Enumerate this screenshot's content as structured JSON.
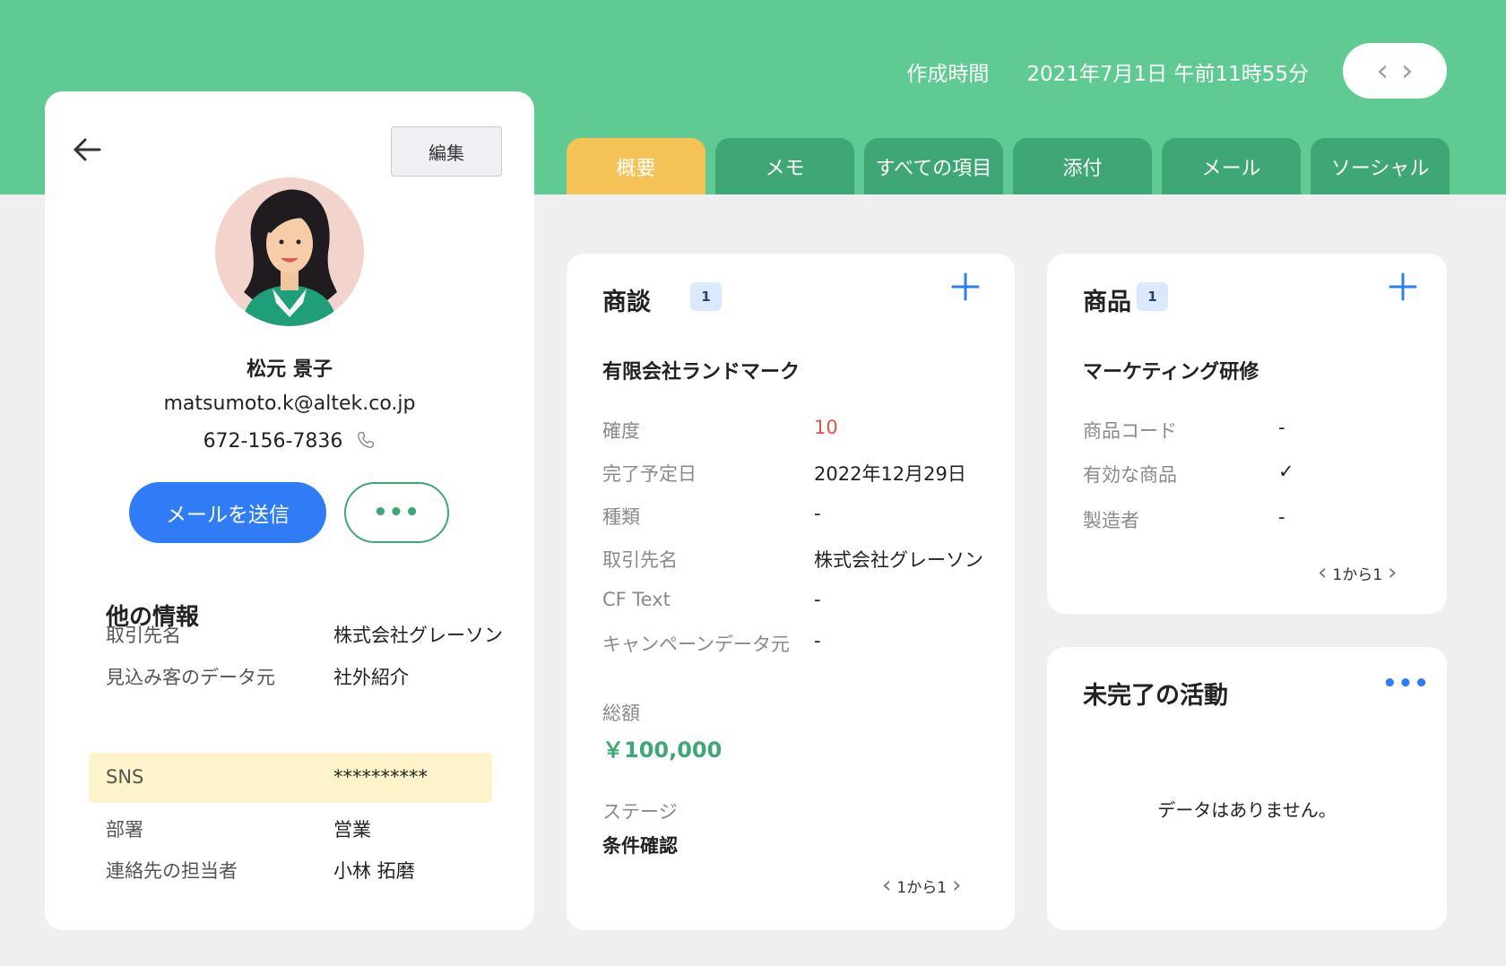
{
  "header": {
    "created_label": "作成時間",
    "created_value": "2021年7月1日 午前11時55分",
    "prev_icon": "chevron-left-icon",
    "next_icon": "chevron-right-icon"
  },
  "tabs": [
    {
      "label": "概要",
      "active": true
    },
    {
      "label": "メモ"
    },
    {
      "label": "すべての項目"
    },
    {
      "label": "添付"
    },
    {
      "label": "メール"
    },
    {
      "label": "ソーシャル"
    }
  ],
  "profile": {
    "edit_label": "編集",
    "name": "松元 景子",
    "email": "matsumoto.k@altek.co.jp",
    "phone": "672-156-7836",
    "send_label": "メールを送信",
    "more_label": "•••",
    "other_title": "他の情報",
    "info": [
      {
        "key": "取引先名",
        "value": "株式会社グレーソン"
      },
      {
        "key": "見込み客のデータ元",
        "value": "社外紹介"
      },
      {
        "key": "SNS",
        "value": "**********",
        "highlight": true
      },
      {
        "key": "部署",
        "value": "営業"
      },
      {
        "key": "連絡先の担当者",
        "value": "小林 拓磨"
      }
    ]
  },
  "deal": {
    "title": "商談",
    "count": "1",
    "company": "有限会社ランドマーク",
    "fields": [
      {
        "key": "確度",
        "value": "10",
        "color": "#e0524a"
      },
      {
        "key": "完了予定日",
        "value": "2022年12月29日"
      },
      {
        "key": "種類",
        "value": "-"
      },
      {
        "key": "取引先名",
        "value": "株式会社グレーソン"
      },
      {
        "key": "CF Text",
        "value": "-"
      },
      {
        "key": "キャンペーンデータ元",
        "value": "-"
      }
    ],
    "total_label": "総額",
    "total_value": "￥100,000",
    "stage_label": "ステージ",
    "stage_value": "条件確認",
    "pager": "1から1"
  },
  "product": {
    "title": "商品",
    "count": "1",
    "name": "マーケティング研修",
    "fields": [
      {
        "key": "商品コード",
        "value": "-"
      },
      {
        "key": "有効な商品",
        "value": "✓"
      },
      {
        "key": "製造者",
        "value": "-"
      }
    ],
    "pager": "1から1"
  },
  "activity": {
    "title": "未完了の活動",
    "more_label": "•••",
    "empty": "データはありません。"
  },
  "colors": {
    "header": "#5fca92",
    "tab": "#3fa775",
    "tab_active": "#f4c257",
    "primary": "#2f7cf6",
    "amount": "#3fa775",
    "highlight": "#fff4c9"
  }
}
